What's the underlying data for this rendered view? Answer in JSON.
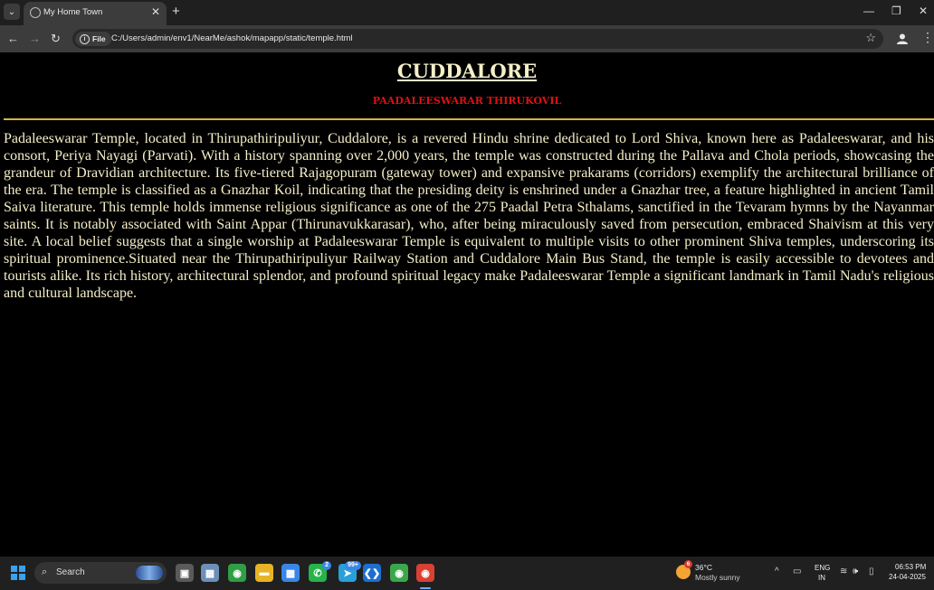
{
  "browser": {
    "tab": {
      "title": "My Home Town",
      "close_glyph": "✕"
    },
    "tab_list_glyph": "⌄",
    "new_tab_glyph": "+",
    "window": {
      "minimize_glyph": "—",
      "restore_glyph": "❐",
      "close_glyph": "✕"
    },
    "nav": {
      "back_glyph": "←",
      "forward_glyph": "→",
      "reload_glyph": "↻"
    },
    "address": {
      "chip_label": "File",
      "info_glyph": "i",
      "url": "C:/Users/admin/env1/NearMe/ashok/mapapp/static/temple.html"
    },
    "bookmark_glyph": "☆",
    "menu_glyph": "⋮"
  },
  "page": {
    "city_title": "CUDDALORE",
    "temple_name": "PAADALEESWARAR THIRUKOVIL",
    "description": "Padaleeswarar Temple, located in Thirupathiripuliyur, Cuddalore, is a revered Hindu shrine dedicated to Lord Shiva, known here as Padaleeswarar, and his consort, Periya Nayagi (Parvati). With a history spanning over 2,000 years, the temple was constructed during the Pallava and Chola periods, showcasing the grandeur of Dravidian architecture. Its five-tiered Rajagopuram (gateway tower) and expansive prakarams (corridors) exemplify the architectural brilliance of the era. The temple is classified as a Gnazhar Koil, indicating that the presiding deity is enshrined under a Gnazhar tree, a feature highlighted in ancient Tamil Saiva literature. This temple holds immense religious significance as one of the 275 Paadal Petra Sthalams, sanctified in the Tevaram hymns by the Nayanmar saints. It is notably associated with Saint Appar (Thirunavukkarasar), who, after being miraculously saved from persecution, embraced Shaivism at this very site. A local belief suggests that a single worship at Padaleeswarar Temple is equivalent to multiple visits to other prominent Shiva temples, underscoring its spiritual prominence.Situated near the Thirupathiripuliyur Railway Station and Cuddalore Main Bus Stand, the temple is easily accessible to devotees and tourists alike. Its rich history, architectural splendor, and profound spiritual legacy make Padaleeswarar Temple a significant landmark in Tamil Nadu's religious and cultural landscape.",
    "colors": {
      "background": "#000000",
      "title": "#f5efc8",
      "subtitle": "#e01010",
      "rule": "#d4b24c",
      "text": "#f5efc8"
    }
  },
  "taskbar": {
    "search": {
      "label": "Search",
      "icon": "search-icon",
      "glyph": "⌕"
    },
    "apps": [
      {
        "name": "task-view-icon",
        "glyph": "▣",
        "color": "#5a5a5a"
      },
      {
        "name": "photos-icon",
        "glyph": "▦",
        "color": "#6d8fb8"
      },
      {
        "name": "chrome-icon",
        "glyph": "◉",
        "color": "#2f9e44"
      },
      {
        "name": "file-explorer-icon",
        "glyph": "▬",
        "color": "#e8b324"
      },
      {
        "name": "store-icon",
        "glyph": "▩",
        "color": "#3a86e8"
      },
      {
        "name": "whatsapp-icon",
        "glyph": "✆",
        "color": "#25b34a",
        "badge": "2"
      },
      {
        "name": "telegram-icon",
        "glyph": "➤",
        "color": "#2a9fd8",
        "badge": "99+"
      },
      {
        "name": "vscode-icon",
        "glyph": "❮❯",
        "color": "#1c6fd1"
      },
      {
        "name": "chrome-profile-icon",
        "glyph": "◉",
        "color": "#3aa84a"
      },
      {
        "name": "chrome-active-icon",
        "glyph": "◉",
        "color": "#d94032"
      }
    ],
    "weather": {
      "badge": "6",
      "temp": "36°C",
      "condition": "Mostly sunny"
    },
    "tray": {
      "chevron_glyph": "^",
      "screen_glyph": "▭",
      "lang_top": "ENG",
      "lang_bottom": "IN",
      "wifi_glyph": "≋",
      "volume_glyph": "🕪",
      "battery_glyph": "▯"
    },
    "clock": {
      "time": "06:53 PM",
      "date": "24-04-2025"
    }
  }
}
